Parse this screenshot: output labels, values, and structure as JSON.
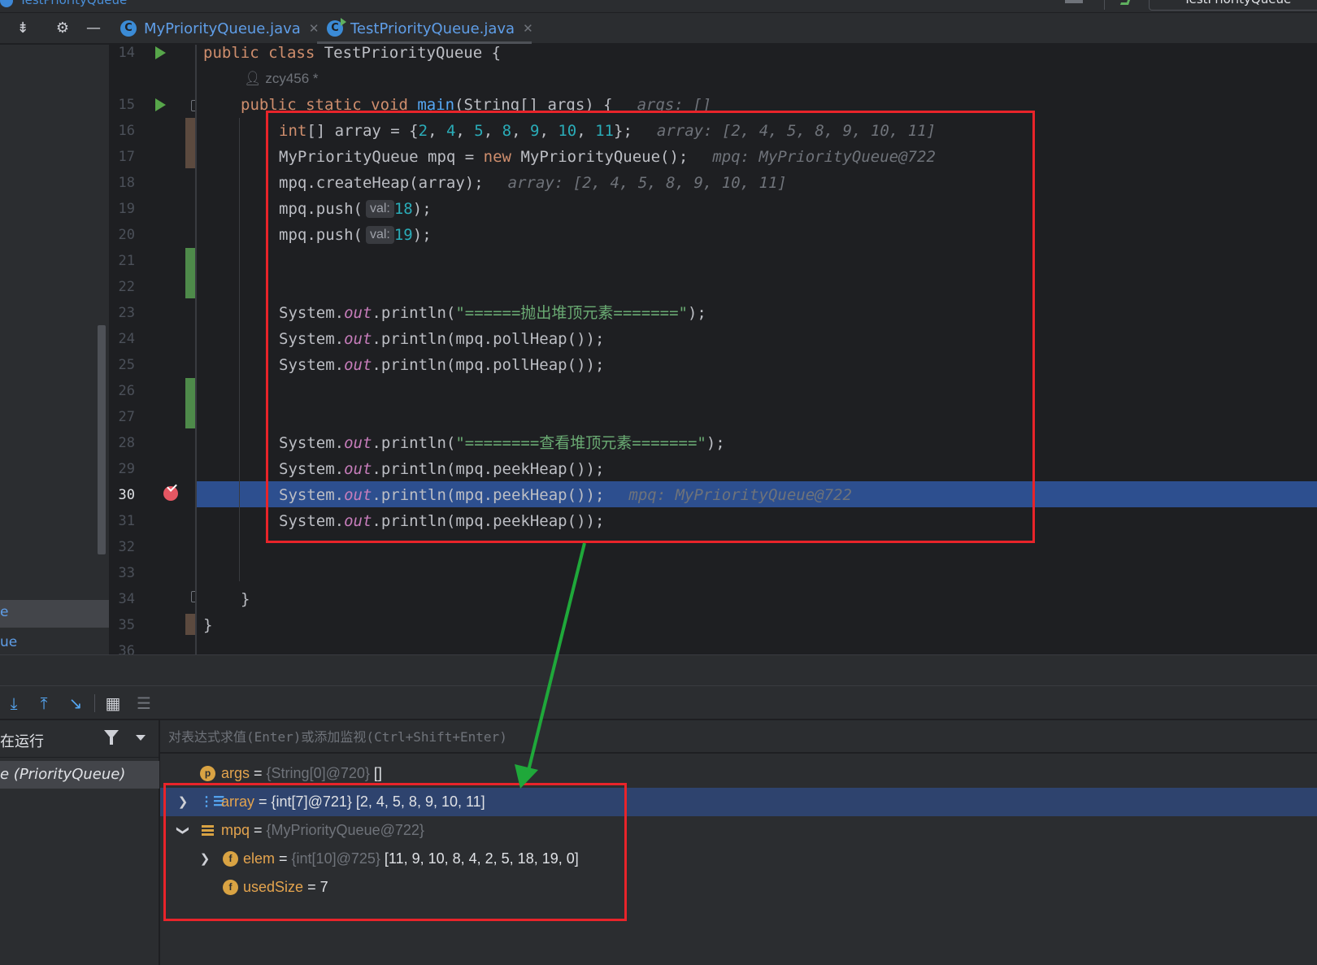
{
  "window": {
    "title": "TestPriorityQueue",
    "run_config": "TestPriorityQueue"
  },
  "tabs": [
    {
      "label": "MyPriorityQueue.java",
      "active": false
    },
    {
      "label": "TestPriorityQueue.java",
      "active": true
    }
  ],
  "left_panel": {
    "item_1": "e",
    "item_2": "ue"
  },
  "editor": {
    "current_line": 30,
    "line_numbers": [
      "14",
      "15",
      "16",
      "17",
      "18",
      "19",
      "20",
      "21",
      "22",
      "23",
      "24",
      "25",
      "26",
      "27",
      "28",
      "29",
      "30",
      "31",
      "32",
      "33",
      "34",
      "35",
      "36"
    ],
    "author_hint": "zcy456 *",
    "line_14": {
      "kw": "public class ",
      "rest": "TestPriorityQueue {"
    },
    "line_15": {
      "kw1": "public static void ",
      "fn": "main",
      "rest": "(String[] args) {",
      "hint": "args: []"
    },
    "line_16": {
      "kw": "int",
      "a": "[] array = {",
      "n1": "2",
      "n2": "4",
      "n3": "5",
      "n4": "8",
      "n5": "9",
      "n6": "10",
      "n7": "11",
      "end": "};",
      "hint": "array: [2, 4, 5, 8, 9, 10, 11]"
    },
    "line_17": {
      "a": "MyPriorityQueue mpq = ",
      "kw": "new",
      "b": " MyPriorityQueue();",
      "hint": "mpq: MyPriorityQueue@722"
    },
    "line_18": {
      "a": "mpq.createHeap(array);",
      "hint": "array: [2, 4, 5, 8, 9, 10, 11]"
    },
    "line_19": {
      "a": "mpq.push(",
      "param": "val:",
      "num": "18",
      "end": ");"
    },
    "line_20": {
      "a": "mpq.push(",
      "param": "val:",
      "num": "19",
      "end": ");"
    },
    "line_23": {
      "a": "System.",
      "fld": "out",
      "b": ".println(",
      "str": "\"======抛出堆顶元素=======\"",
      "end": ");"
    },
    "line_24": {
      "a": "System.",
      "fld": "out",
      "b": ".println(mpq.pollHeap());"
    },
    "line_25": {
      "a": "System.",
      "fld": "out",
      "b": ".println(mpq.pollHeap());"
    },
    "line_28": {
      "a": "System.",
      "fld": "out",
      "b": ".println(",
      "str": "\"========查看堆顶元素=======\"",
      "end": ");"
    },
    "line_29": {
      "a": "System.",
      "fld": "out",
      "b": ".println(mpq.peekHeap());"
    },
    "line_30": {
      "a": "System.",
      "fld": "out",
      "b": ".println(mpq.peekHeap());",
      "hint": "mpq: MyPriorityQueue@722"
    },
    "line_31": {
      "a": "System.",
      "fld": "out",
      "b": ".println(mpq.peekHeap());"
    },
    "line_34": {
      "a": "}"
    },
    "line_35": {
      "a": "}"
    }
  },
  "debugger": {
    "frames_header": "在运行",
    "frame_item": "e (PriorityQueue)",
    "eval_placeholder": "对表达式求值(Enter)或添加监视(Ctrl+Shift+Enter)",
    "variables": [
      {
        "icon": "p",
        "name": "args",
        "eq": " = ",
        "type": "{String[0]@720}",
        "value": " []"
      },
      {
        "icon": "array-icon",
        "name": "array",
        "eq": " = ",
        "type": "{int[7]@721}",
        "value": " [2, 4, 5, 8, 9, 10, 11]",
        "selected": true
      },
      {
        "icon": "object-icon",
        "name": "mpq",
        "eq": " = ",
        "type": "{MyPriorityQueue@722}",
        "value": ""
      },
      {
        "icon": "f",
        "name": "elem",
        "eq": " = ",
        "type": "{int[10]@725}",
        "value": " [11, 9, 10, 8, 4, 2, 5, 18, 19, 0]"
      },
      {
        "icon": "f",
        "name": "usedSize",
        "eq": " = ",
        "type": "",
        "value": "7"
      }
    ]
  },
  "colors": {
    "annotation_box": "#e8242a",
    "annotation_arrow": "#1fa83a",
    "execution_line": "#2d4f8f",
    "breakpoint": "#e55763"
  }
}
